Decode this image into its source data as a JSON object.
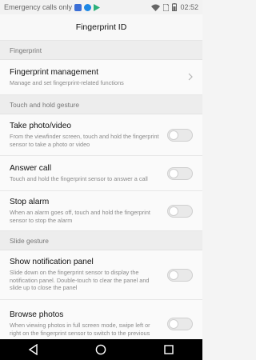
{
  "status_bar": {
    "left_text": "Emergency calls only",
    "time": "02:52",
    "icons": [
      "app-icon-blue",
      "messenger-icon",
      "play-store-icon",
      "wifi-icon",
      "sim-icon",
      "battery-icon"
    ]
  },
  "header": {
    "title": "Fingerprint ID"
  },
  "sections": {
    "fingerprint": "Fingerprint",
    "touch_hold": "Touch and hold gesture",
    "slide": "Slide gesture"
  },
  "items": {
    "management": {
      "title": "Fingerprint management",
      "desc": "Manage and set fingerprint-related functions"
    },
    "take_photo": {
      "title": "Take photo/video",
      "desc": "From the viewfinder screen, touch and hold the fingerprint sensor to take a photo or video",
      "enabled": false
    },
    "answer_call": {
      "title": "Answer call",
      "desc": "Touch and hold the fingerprint sensor to answer a call",
      "enabled": false
    },
    "stop_alarm": {
      "title": "Stop alarm",
      "desc": "When an alarm goes off, touch and hold the fingerprint sensor to stop the alarm",
      "enabled": false
    },
    "notification_panel": {
      "title": "Show notification panel",
      "desc": "Slide down on the fingerprint sensor to display the notification panel. Double-touch to clear the panel and slide up to close the panel",
      "enabled": false
    },
    "browse_photos": {
      "title": "Browse photos",
      "desc": "When viewing photos in full screen mode, swipe left or right on the fingerprint sensor to switch to the previous",
      "enabled": false
    }
  },
  "nav_bar": {
    "icons": [
      "back-icon",
      "home-icon",
      "recents-icon"
    ]
  },
  "colors": {
    "toggle_off": "#e9e9e9",
    "nav_bg": "#000000",
    "section_bg": "#ededed"
  }
}
